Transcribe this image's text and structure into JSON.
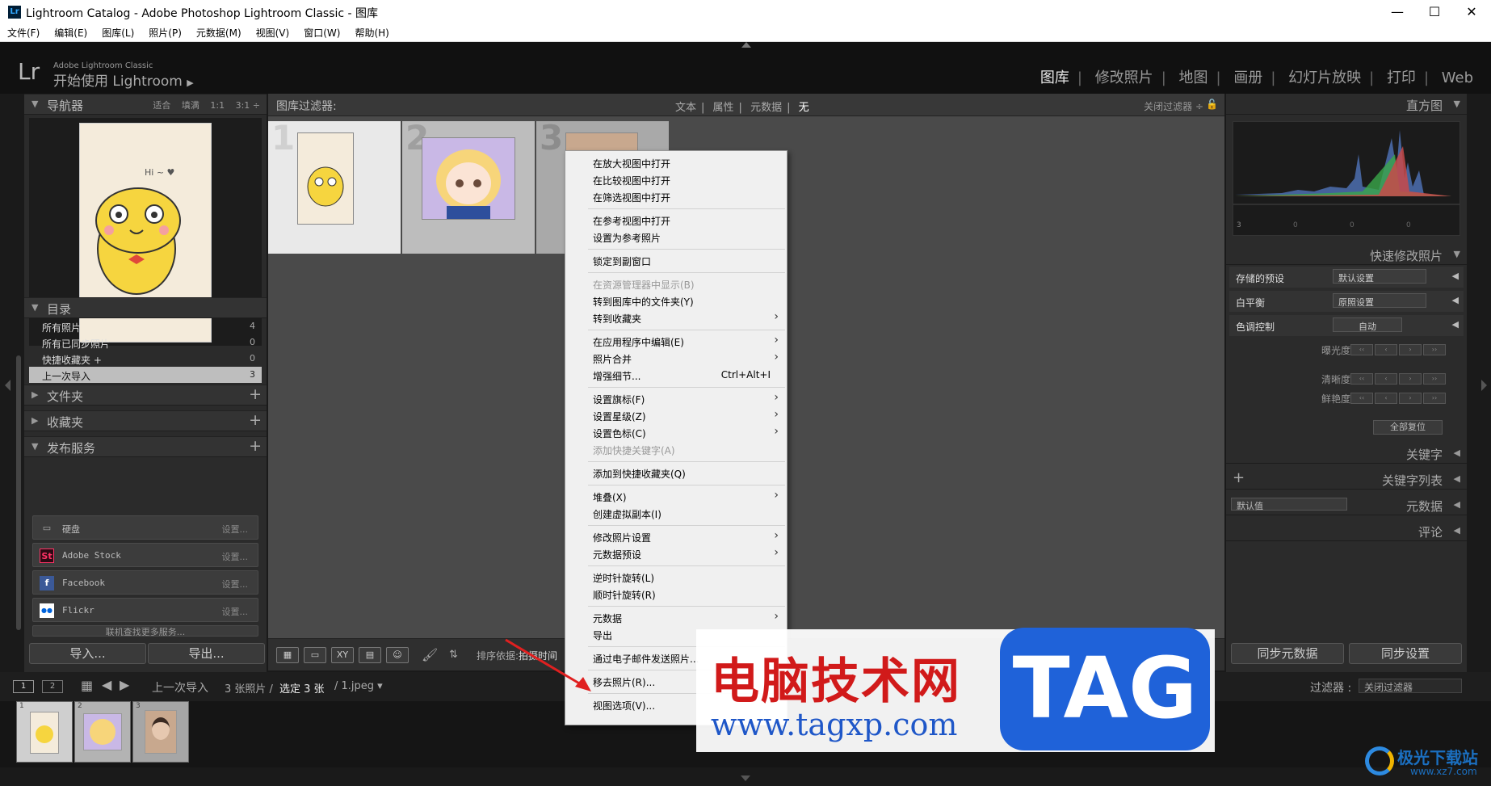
{
  "titlebar": {
    "title": "Lightroom Catalog - Adobe Photoshop Lightroom Classic - 图库",
    "icon": "Lr"
  },
  "menubar": [
    "文件(F)",
    "编辑(E)",
    "图库(L)",
    "照片(P)",
    "元数据(M)",
    "视图(V)",
    "窗口(W)",
    "帮助(H)"
  ],
  "identity": {
    "logo": "Lr",
    "brand": "Adobe Lightroom Classic",
    "title": "开始使用 Lightroom",
    "arrow": "▶"
  },
  "modules": [
    "图库",
    "修改照片",
    "地图",
    "画册",
    "幻灯片放映",
    "打印",
    "Web"
  ],
  "navigator": {
    "title": "导航器",
    "options": [
      "适合",
      "填满",
      "1:1",
      "3:1"
    ],
    "image_caption": "Hi ~ ♥"
  },
  "catalog": {
    "title": "目录",
    "items": [
      {
        "label": "所有照片",
        "count": "4"
      },
      {
        "label": "所有已同步照片",
        "count": "0"
      },
      {
        "label": "快捷收藏夹 +",
        "count": "0"
      },
      {
        "label": "上一次导入",
        "count": "3"
      }
    ]
  },
  "folders": {
    "title": "文件夹"
  },
  "collections": {
    "title": "收藏夹"
  },
  "publish": {
    "title": "发布服务",
    "items": [
      {
        "icon": "▭",
        "label": "硬盘",
        "setup": "设置..."
      },
      {
        "icon": "St",
        "label": "Adobe Stock",
        "setup": "设置..."
      },
      {
        "icon": "f",
        "label": "Facebook",
        "setup": "设置..."
      },
      {
        "icon": "●●",
        "label": "Flickr",
        "setup": "设置..."
      }
    ],
    "more": "联机查找更多服务..."
  },
  "left_buttons": {
    "import": "导入...",
    "export": "导出..."
  },
  "filterbar": {
    "title": "图库过滤器:",
    "options": [
      "文本",
      "属性",
      "元数据",
      "无"
    ],
    "close": "关闭过滤器 ÷"
  },
  "grid": {
    "cells": [
      "1",
      "2",
      "3"
    ]
  },
  "toolbar": {
    "sort_label": "排序依据:",
    "sort_value": "拍摄时间"
  },
  "context_menu": {
    "items": [
      {
        "label": "在放大视图中打开"
      },
      {
        "label": "在比较视图中打开"
      },
      {
        "label": "在筛选视图中打开"
      },
      {
        "label": "在参考视图中打开"
      },
      {
        "label": "设置为参考照片"
      },
      {
        "label": "锁定到副窗口"
      },
      {
        "label": "在资源管理器中显示(B)"
      },
      {
        "label": "转到图库中的文件夹(Y)"
      },
      {
        "label": "转到收藏夹"
      },
      {
        "label": "在应用程序中编辑(E)"
      },
      {
        "label": "照片合并"
      },
      {
        "label": "增强细节...",
        "shortcut": "Ctrl+Alt+I"
      },
      {
        "label": "设置旗标(F)"
      },
      {
        "label": "设置星级(Z)"
      },
      {
        "label": "设置色标(C)"
      },
      {
        "label": "添加快捷关键字(A)"
      },
      {
        "label": "添加到快捷收藏夹(Q)"
      },
      {
        "label": "堆叠(X)"
      },
      {
        "label": "创建虚拟副本(I)"
      },
      {
        "label": "修改照片设置"
      },
      {
        "label": "元数据预设"
      },
      {
        "label": "逆时针旋转(L)"
      },
      {
        "label": "顺时针旋转(R)"
      },
      {
        "label": "元数据"
      },
      {
        "label": "导出"
      },
      {
        "label": "通过电子邮件发送照片..."
      },
      {
        "label": "移去照片(R)..."
      },
      {
        "label": "视图选项(V)..."
      }
    ],
    "arrow": "›"
  },
  "histogram": {
    "title": "直方图",
    "readouts": [
      "3",
      "0",
      "0",
      "0"
    ]
  },
  "quick_develop": {
    "title": "快速修改照片",
    "saved_preset": {
      "label": "存储的预设",
      "value": "默认设置"
    },
    "white_balance": {
      "label": "白平衡",
      "value": "原照设置"
    },
    "tone": {
      "label": "色调控制",
      "auto": "自动"
    },
    "adjust": [
      "曝光度",
      "清晰度",
      "鲜艳度"
    ],
    "reset": "全部复位"
  },
  "right_sections": {
    "keywording": "关键字",
    "keyword_list": "关键字列表",
    "metadata": "元数据",
    "metadata_preset": "默认值",
    "comments": "评论"
  },
  "right_buttons": {
    "sync_meta": "同步元数据",
    "sync_settings": "同步设置"
  },
  "filmstrip": {
    "views": [
      "1",
      "2"
    ],
    "source": "上一次导入",
    "count": "3 张照片 /",
    "selected": "选定 3 张",
    "file": "/ 1.jpeg ▾",
    "filter_label": "过滤器 :",
    "filter_value": "关闭过滤器",
    "thumbs": [
      "1",
      "2",
      "3"
    ]
  },
  "watermark": {
    "cn": "电脑技术网",
    "url": "www.tagxp.com",
    "tag": "TAG"
  },
  "corner_logo": {
    "name": "极光下载站",
    "url": "www.xz7.com"
  },
  "colors": {
    "accent": "#1f62d9",
    "watermark_red": "#d11a1a",
    "panel": "#2b2b2b"
  }
}
